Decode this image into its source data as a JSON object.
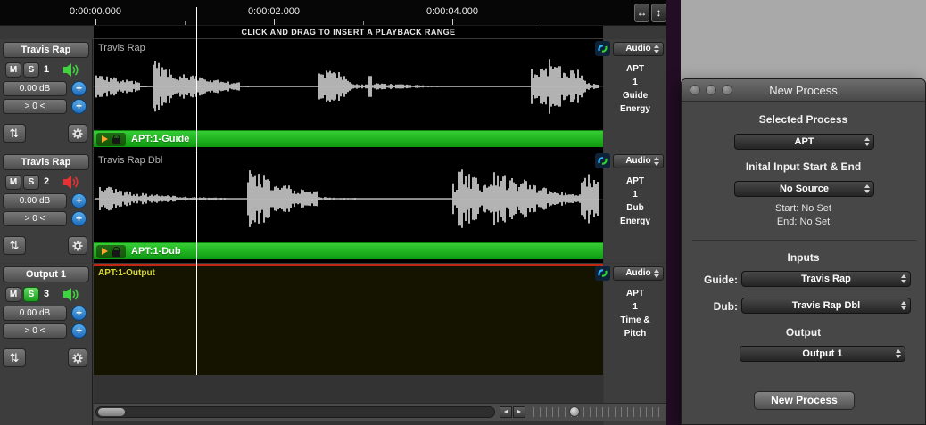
{
  "icons": {
    "swap": "⇅",
    "resize_horizontal": "↔",
    "resize_vertical": "↕",
    "scroll_left": "◄",
    "scroll_right": "►",
    "plus": "+"
  },
  "colors": {
    "speaker_active": "#3fd43f",
    "speaker_muted_red": "#e63232",
    "solo_active_green": "#3fd43f",
    "process_bar_green": "#1db41d",
    "add_button_blue": "#2f82d6",
    "output_clip_red_line": "#c22713",
    "output_label_yellow": "#d6d637"
  },
  "ruler": {
    "labels": [
      "0:00:00.000",
      "0:00:02.000",
      "0:00:04.000"
    ],
    "banner": "CLICK AND DRAG TO INSERT A PLAYBACK RANGE"
  },
  "tracks": [
    {
      "name": "Travis Rap",
      "mute": "M",
      "solo": "S",
      "number": "1",
      "gain": "0.00 dB",
      "range": "> 0 <",
      "clip_label": "Travis Rap",
      "bar_label": "APT:1-Guide",
      "audio": "Audio",
      "info": [
        "APT",
        "1",
        "Guide",
        "Energy"
      ]
    },
    {
      "name": "Travis Rap",
      "mute": "M",
      "solo": "S",
      "number": "2",
      "gain": "0.00 dB",
      "range": "> 0 <",
      "clip_label": "Travis Rap Dbl",
      "bar_label": "APT:1-Dub",
      "audio": "Audio",
      "info": [
        "APT",
        "1",
        "Dub",
        "Energy"
      ]
    },
    {
      "name": "Output 1",
      "mute": "M",
      "solo": "S",
      "number": "3",
      "gain": "0.00 dB",
      "range": "> 0 <",
      "clip_label": "APT:1-Output",
      "audio": "Audio",
      "info": [
        "APT",
        "1",
        "Time &",
        "Pitch"
      ]
    }
  ],
  "dialog": {
    "title": "New Process",
    "selected_process_label": "Selected Process",
    "process_value": "APT",
    "initial_input_label": "Inital Input Start & End",
    "source_value": "No Source",
    "start_text": "Start: No Set",
    "end_text": "End: No Set",
    "inputs_label": "Inputs",
    "guide_label": "Guide:",
    "guide_value": "Travis Rap",
    "dub_label": "Dub:",
    "dub_value": "Travis Rap Dbl",
    "output_label": "Output",
    "output_value": "Output 1",
    "new_process_button": "New Process"
  }
}
